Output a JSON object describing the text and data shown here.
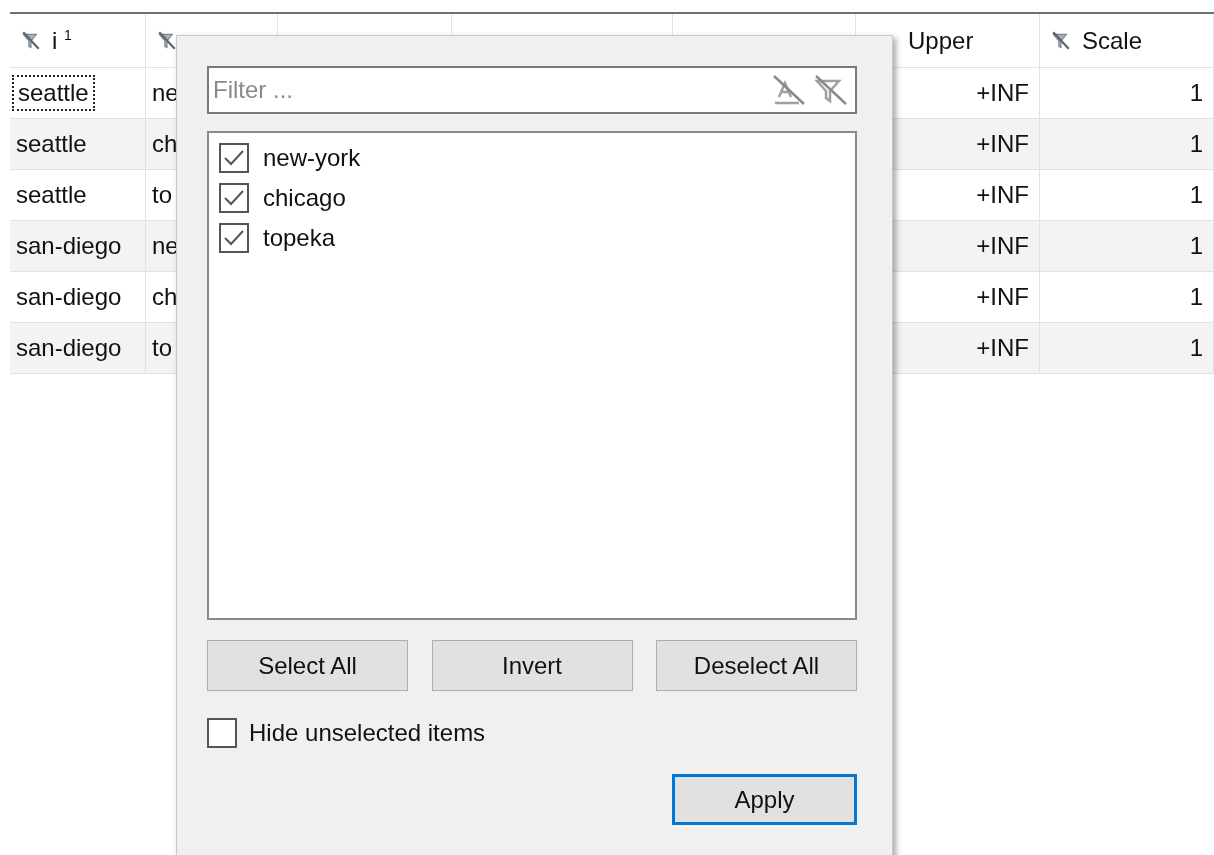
{
  "table": {
    "columns": [
      {
        "label": "i $^{1}$",
        "filter_icon": true
      },
      {
        "filter_icon": true
      },
      {},
      {},
      {},
      {
        "label": "Upper"
      },
      {
        "label": "Scale",
        "filter_icon": true
      }
    ],
    "rows": [
      {
        "cells": [
          "seattle",
          "ne",
          null,
          null,
          null,
          "+INF",
          "1"
        ],
        "focused": true
      },
      {
        "cells": [
          "seattle",
          "ch",
          null,
          null,
          null,
          "+INF",
          "1"
        ],
        "focused": false
      },
      {
        "cells": [
          "seattle",
          "to",
          null,
          null,
          null,
          "+INF",
          "1"
        ],
        "focused": false
      },
      {
        "cells": [
          "san-diego",
          "ne",
          null,
          null,
          null,
          "+INF",
          "1"
        ],
        "focused": false
      },
      {
        "cells": [
          "san-diego",
          "ch",
          null,
          null,
          null,
          "+INF",
          "1"
        ],
        "focused": false
      },
      {
        "cells": [
          "san-diego",
          "to",
          null,
          null,
          null,
          "+INF",
          "1"
        ],
        "focused": false
      }
    ]
  },
  "filter_popup": {
    "filter_field": {
      "placeholder": "Filter ..."
    },
    "items": [
      {
        "label": "new-york",
        "checked": true
      },
      {
        "label": "chicago",
        "checked": true
      },
      {
        "label": "topeka",
        "checked": true
      }
    ],
    "buttons": [
      "Select All",
      "Invert",
      "Deselect All"
    ],
    "hide_unselected": {
      "label": "Hide unselected items",
      "checked": false
    },
    "apply_button": {
      "label": "Apply",
      "default": true
    }
  }
}
